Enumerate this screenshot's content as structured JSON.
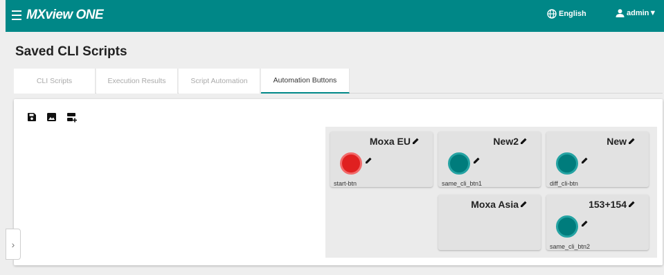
{
  "app": {
    "brand": "MXview ONE"
  },
  "header": {
    "language": "English",
    "user": "admin",
    "user_caret": "▼"
  },
  "page": {
    "title": "Saved CLI Scripts"
  },
  "tabs": [
    {
      "label": "CLI Scripts",
      "active": false
    },
    {
      "label": "Execution Results",
      "active": false
    },
    {
      "label": "Script Automation",
      "active": false
    },
    {
      "label": "Automation Buttons",
      "active": true
    }
  ],
  "toolbar": {
    "icons": [
      "save-icon",
      "image-icon",
      "add-button-icon"
    ]
  },
  "automation_buttons": [
    {
      "title": "Moxa EU",
      "label": "start-btn",
      "color": "red"
    },
    {
      "title": "New2",
      "label": "same_cli_btn1",
      "color": "teal"
    },
    {
      "title": "New",
      "label": "diff_cli-btn",
      "color": "teal"
    },
    {
      "title": "Moxa Asia",
      "label": "",
      "color": "none"
    },
    {
      "title": "153+154",
      "label": "same_cli_btn2",
      "color": "teal"
    }
  ],
  "colors": {
    "brand": "#008787",
    "teal_button": "#007c7c",
    "red_button": "#e02020"
  },
  "side_toggle": {
    "glyph": "›"
  }
}
